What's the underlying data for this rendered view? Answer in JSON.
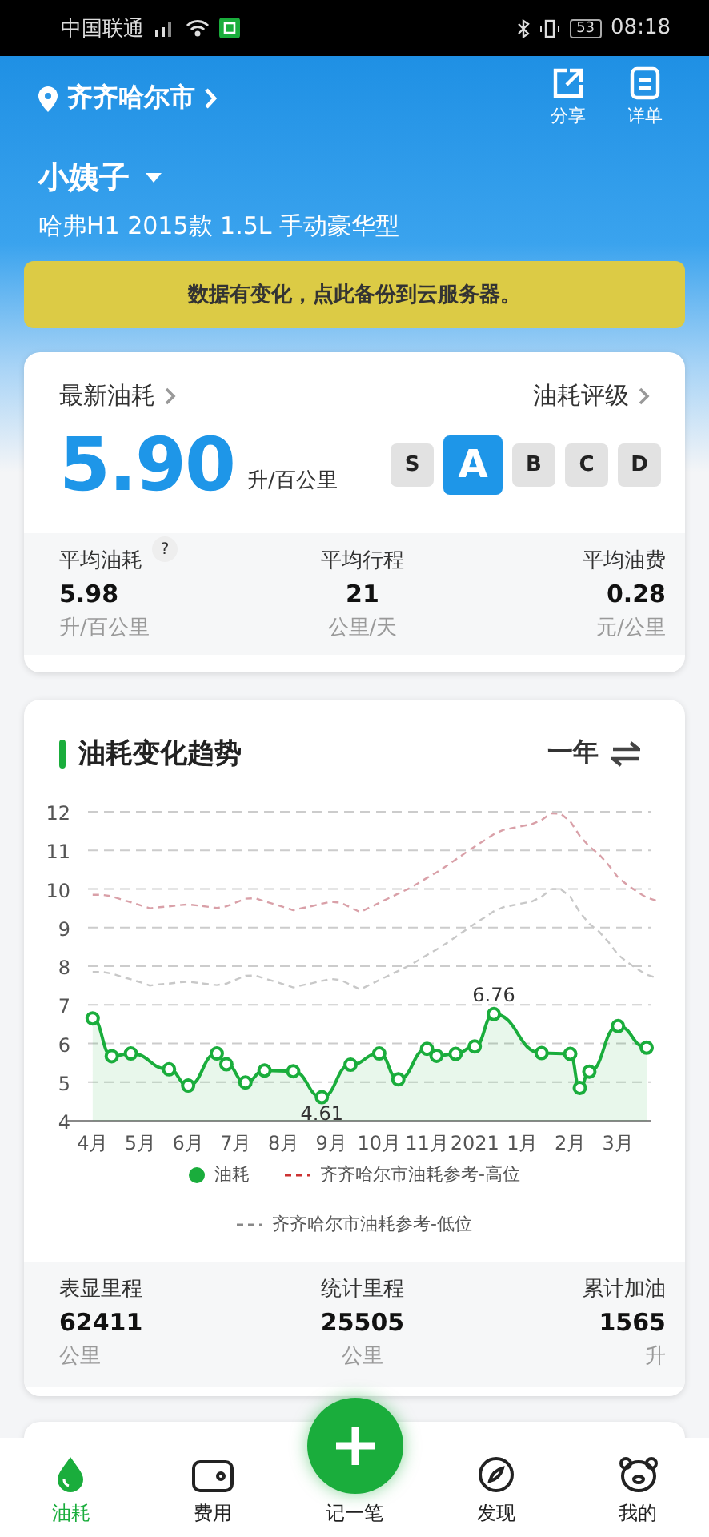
{
  "status_bar": {
    "carrier": "中国联通",
    "battery": "53",
    "time": "08:18"
  },
  "header": {
    "city": "齐齐哈尔市",
    "actions": [
      {
        "label": "分享",
        "kind": "share"
      },
      {
        "label": "详单",
        "kind": "list"
      }
    ],
    "car_name": "小姨子",
    "car_model": "哈弗H1 2015款 1.5L 手动豪华型"
  },
  "banner": "数据有变化，点此备份到云服务器。",
  "summary": {
    "latest_label": "最新油耗",
    "latest_value": "5.90",
    "latest_unit": "升/百公里",
    "rating_label": "油耗评级",
    "grades": [
      {
        "label": "S",
        "selected": false
      },
      {
        "label": "A",
        "selected": true
      },
      {
        "label": "B",
        "selected": false
      },
      {
        "label": "C",
        "selected": false
      },
      {
        "label": "D",
        "selected": false
      }
    ],
    "stats": [
      {
        "label": "平均油耗",
        "help": "?",
        "value": "5.98",
        "unit": "升/百公里"
      },
      {
        "label": "平均行程",
        "value": "21",
        "unit": "公里/天"
      },
      {
        "label": "平均油费",
        "value": "0.28",
        "unit": "元/公里"
      }
    ]
  },
  "trend": {
    "title": "油耗变化趋势",
    "period": "一年",
    "chart_data": {
      "type": "line",
      "categories": [
        "4月",
        null,
        null,
        null,
        null,
        "5月",
        null,
        null,
        null,
        null,
        "6月",
        null,
        null,
        null,
        null,
        "7月",
        null,
        null,
        null,
        null,
        "8月",
        null,
        null,
        null,
        null,
        "9月",
        null,
        null,
        null,
        null,
        "10月",
        null,
        null,
        null,
        null,
        "11月",
        null,
        null,
        null,
        null,
        "2021",
        null,
        null,
        null,
        null,
        "1月",
        null,
        null,
        null,
        null,
        "2月",
        null,
        null,
        null,
        null,
        "3月",
        null,
        null,
        null,
        null
      ],
      "yticks": [
        4,
        5,
        6,
        7,
        8,
        9,
        10,
        11,
        12
      ],
      "ylim": [
        4,
        12
      ],
      "grid": true,
      "series": [
        {
          "name": "油耗",
          "color": "#1aad3c",
          "marker": "circle",
          "values": [
            6.65,
            null,
            5.67,
            null,
            5.74,
            null,
            null,
            null,
            5.33,
            null,
            4.91,
            null,
            null,
            5.74,
            5.46,
            null,
            4.99,
            null,
            5.3,
            null,
            null,
            5.28,
            null,
            null,
            4.61,
            null,
            null,
            5.45,
            null,
            null,
            5.74,
            null,
            5.07,
            null,
            null,
            5.86,
            5.68,
            null,
            5.73,
            null,
            5.92,
            null,
            6.76,
            null,
            null,
            null,
            null,
            5.75,
            null,
            null,
            5.73,
            4.85,
            5.27,
            null,
            null,
            6.45,
            null,
            null,
            5.89,
            null
          ]
        },
        {
          "name": "齐齐哈尔市油耗参考-高位",
          "color": "#d9a0a8",
          "line_style": "dashed",
          "values": [
            9.85,
            9.85,
            9.81,
            9.73,
            9.66,
            9.58,
            9.5,
            9.53,
            9.55,
            9.58,
            9.6,
            9.57,
            9.54,
            9.51,
            9.55,
            9.65,
            9.75,
            9.76,
            9.68,
            9.61,
            9.53,
            9.45,
            9.51,
            9.56,
            9.62,
            9.67,
            9.64,
            9.52,
            9.4,
            9.52,
            9.64,
            9.76,
            9.88,
            10.0,
            10.14,
            10.29,
            10.43,
            10.59,
            10.76,
            10.93,
            11.1,
            11.26,
            11.42,
            11.53,
            11.58,
            11.63,
            11.68,
            11.79,
            11.96,
            11.95,
            11.75,
            11.38,
            11.1,
            10.9,
            10.63,
            10.3,
            10.1,
            9.93,
            9.78,
            9.7
          ]
        },
        {
          "name": "齐齐哈尔市油耗参考-低位",
          "color": "#c8c8c8",
          "line_style": "dashed",
          "values": [
            7.85,
            7.85,
            7.81,
            7.73,
            7.66,
            7.58,
            7.5,
            7.53,
            7.55,
            7.58,
            7.6,
            7.57,
            7.54,
            7.51,
            7.55,
            7.65,
            7.75,
            7.76,
            7.68,
            7.61,
            7.53,
            7.45,
            7.51,
            7.56,
            7.62,
            7.67,
            7.64,
            7.52,
            7.4,
            7.52,
            7.64,
            7.76,
            7.88,
            8.0,
            8.14,
            8.29,
            8.43,
            8.59,
            8.76,
            8.93,
            9.1,
            9.26,
            9.42,
            9.53,
            9.58,
            9.63,
            9.68,
            9.8,
            10.0,
            10.0,
            9.8,
            9.4,
            9.1,
            8.9,
            8.63,
            8.3,
            8.1,
            7.93,
            7.78,
            7.7
          ]
        }
      ],
      "annotations": [
        {
          "y": 6.76,
          "text": "6.76"
        },
        {
          "y": 4.61,
          "text": "4.61"
        }
      ]
    }
  },
  "totals": [
    {
      "label": "表显里程",
      "value": "62411",
      "unit": "公里"
    },
    {
      "label": "统计里程",
      "value": "25505",
      "unit": "公里"
    },
    {
      "label": "累计加油",
      "value": "1565",
      "unit": "升"
    }
  ],
  "tab_bar": [
    {
      "label": "油耗",
      "kind": "drop",
      "selected": true
    },
    {
      "label": "费用",
      "kind": "wallet",
      "selected": false
    },
    {
      "label": "记一笔",
      "kind": "add",
      "selected": false
    },
    {
      "label": "发现",
      "kind": "compass",
      "selected": false
    },
    {
      "label": "我的",
      "kind": "bear",
      "selected": false
    }
  ]
}
